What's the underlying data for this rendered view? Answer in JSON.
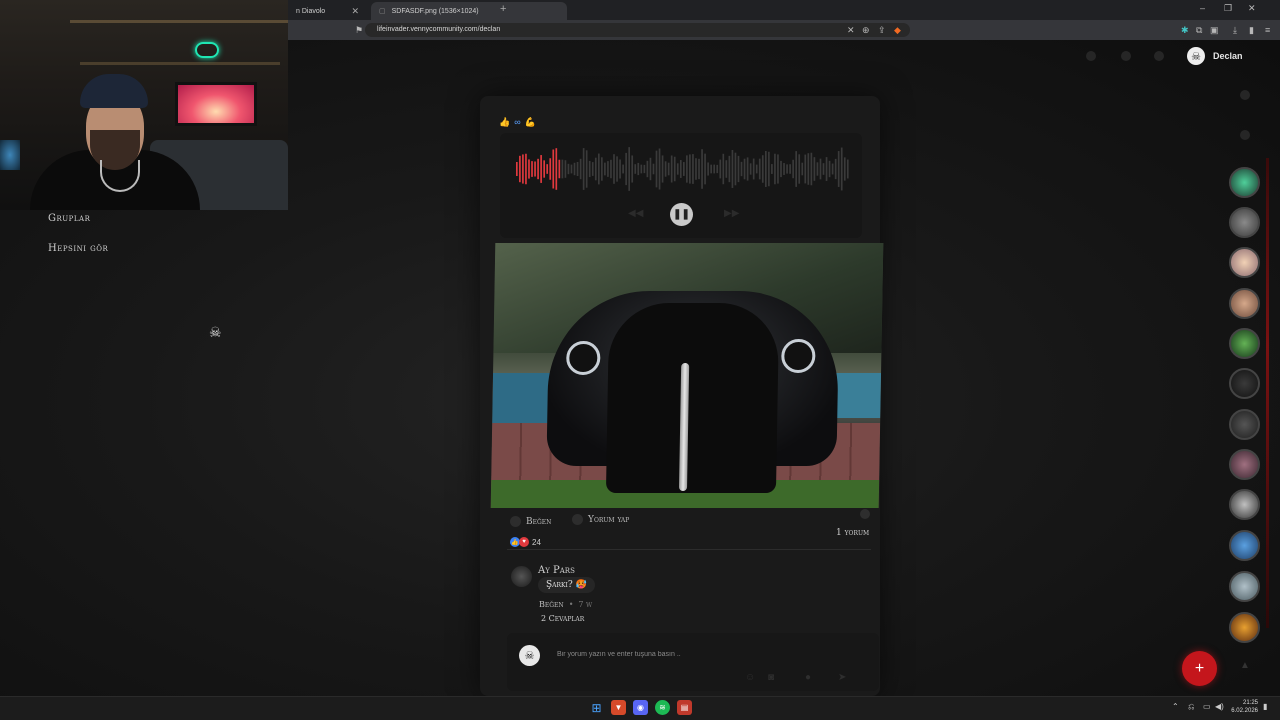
{
  "browser": {
    "tabs": [
      {
        "title": "n Diavolo",
        "close": "✕"
      },
      {
        "title": "SDFASDF.png (1536×1024)",
        "close": "✕"
      }
    ],
    "new_tab": "+",
    "url": "lifeinvader.vennycommunity.com/declan",
    "window_controls": [
      "–",
      "❐",
      "✕"
    ]
  },
  "sidebar": {
    "groups_link": "Gruplar",
    "see_all_link": "Hepsini gör"
  },
  "user": {
    "name": "Declan",
    "avatar_icon": "skull-avatar-icon"
  },
  "post": {
    "reaction_icons": [
      "like-icon",
      "infinity-icon",
      "strong-arm-icon"
    ],
    "audio": {
      "state": "playing",
      "progress": 0.13,
      "accent": "#e0393e"
    },
    "actions": {
      "like": "Beğen",
      "comment": "Yorum yap"
    },
    "likes": "24",
    "comment_count": "1 yorum",
    "comment": {
      "author": "Ay Pars",
      "text": "Şarkı? 🥵",
      "like": "Beğen",
      "sep": "•",
      "time": "7 w",
      "replies": "2 Cevaplar"
    },
    "input_placeholder": "Bir yorum yazın ve enter tuşuna basın .."
  },
  "fab": {
    "label": "+",
    "color": "#c4161c"
  },
  "taskbar": {
    "time": "21:25",
    "date": "6.02.2026",
    "apps": [
      "windows-start-icon",
      "brave-browser-icon",
      "discord-icon",
      "spotify-icon",
      "calendar-app-icon"
    ]
  },
  "colors": {
    "accent_red": "#c4161c",
    "background": "#141414",
    "card": "#1a1a1a"
  }
}
